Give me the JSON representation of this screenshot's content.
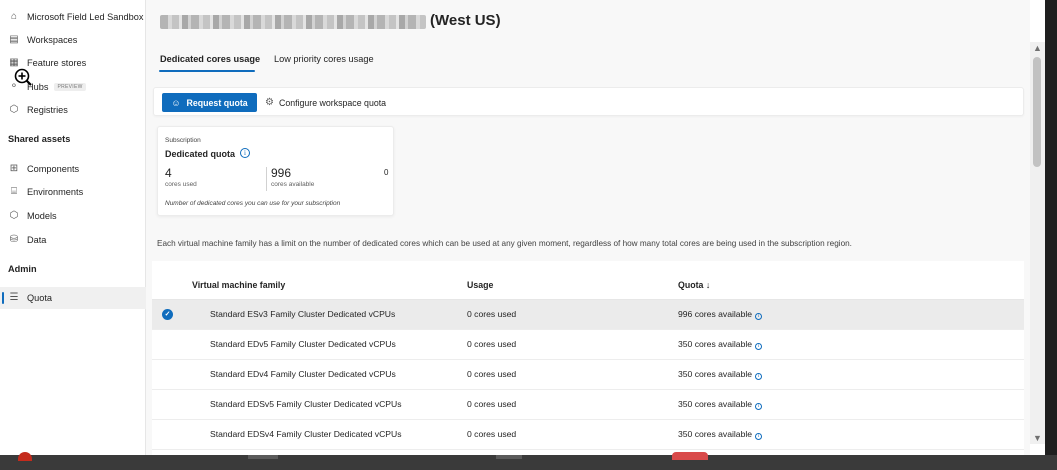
{
  "sidebar": {
    "items": [
      {
        "label": "Microsoft Field Led Sandbox",
        "icon": "home-icon"
      },
      {
        "label": "Workspaces",
        "icon": "workspaces-icon"
      },
      {
        "label": "Feature stores",
        "icon": "feature-store-icon"
      },
      {
        "label": "Hubs",
        "icon": "hubs-icon",
        "badge": "PREVIEW"
      },
      {
        "label": "Registries",
        "icon": "registries-icon"
      }
    ],
    "shared_assets_heading": "Shared assets",
    "shared_items": [
      {
        "label": "Components",
        "icon": "components-icon"
      },
      {
        "label": "Environments",
        "icon": "environments-icon"
      },
      {
        "label": "Models",
        "icon": "models-icon"
      },
      {
        "label": "Data",
        "icon": "data-icon"
      }
    ],
    "admin_heading": "Admin",
    "admin_items": [
      {
        "label": "Quota",
        "icon": "quota-icon",
        "active": true
      }
    ]
  },
  "header": {
    "region": "(West US)"
  },
  "tabs": [
    {
      "label": "Dedicated cores usage",
      "active": true
    },
    {
      "label": "Low priority cores usage",
      "active": false
    }
  ],
  "toolbar": {
    "request_quota": "Request quota",
    "configure": "Configure workspace quota"
  },
  "quota_card": {
    "eyebrow": "Subscription",
    "heading": "Dedicated quota",
    "used_value": "4",
    "used_label": "cores used",
    "available_value": "996",
    "available_label": "cores available",
    "third_value": "0",
    "note": "Number of dedicated cores you can use for your subscription"
  },
  "description": "Each virtual machine family has a limit on the number of dedicated cores which can be used at any given moment, regardless of how many total cores are being used in the subscription region.",
  "table": {
    "columns": [
      "Virtual machine family",
      "Usage",
      "Quota ↓"
    ],
    "rows": [
      {
        "family": "Standard ESv3 Family Cluster Dedicated vCPUs",
        "usage": "0 cores used",
        "quota": "996 cores available",
        "selected": true
      },
      {
        "family": "Standard EDv5 Family Cluster Dedicated vCPUs",
        "usage": "0 cores used",
        "quota": "350 cores available",
        "selected": false
      },
      {
        "family": "Standard EDv4 Family Cluster Dedicated vCPUs",
        "usage": "0 cores used",
        "quota": "350 cores available",
        "selected": false
      },
      {
        "family": "Standard EDSv5 Family Cluster Dedicated vCPUs",
        "usage": "0 cores used",
        "quota": "350 cores available",
        "selected": false
      },
      {
        "family": "Standard EDSv4 Family Cluster Dedicated vCPUs",
        "usage": "0 cores used",
        "quota": "350 cores available",
        "selected": false
      }
    ]
  },
  "colors": {
    "accent": "#0f6cbd",
    "selected_row": "#ebebeb",
    "page_bg": "#f8f8f8"
  }
}
